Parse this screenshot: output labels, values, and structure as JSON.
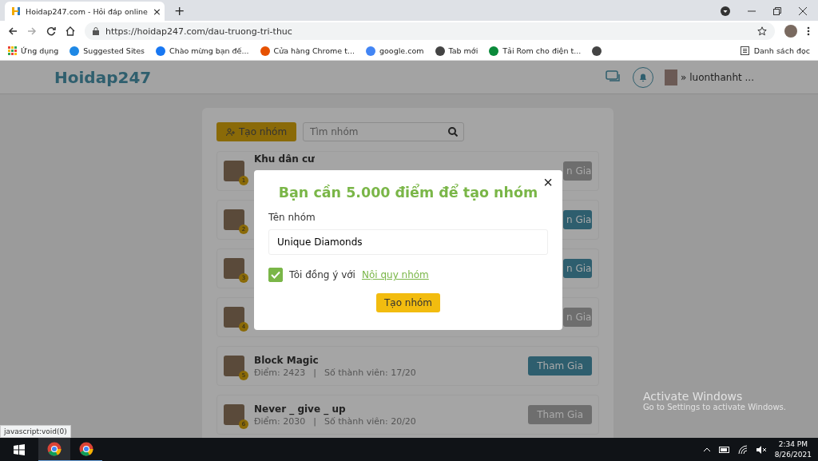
{
  "browser": {
    "tab_title": "Hoidap247.com - Hỏi đáp online",
    "close_tab": "×",
    "new_tab": "+",
    "url": "https://hoidap247.com/dau-truong-tri-thuc",
    "bookmarks": [
      "Ứng dụng",
      "Suggested Sites",
      "Chào mừng bạn đế...",
      "Cửa hàng Chrome t...",
      "google.com",
      "Tab mới",
      "Tải Rom cho điện t..."
    ],
    "reading_list": "Danh sách đọc"
  },
  "header": {
    "logo": "Hoidap247",
    "username_caret": "»",
    "username": "luonthanht ..."
  },
  "toolbar": {
    "create_button": "Tạo nhóm",
    "search_placeholder": "Tìm nhóm"
  },
  "groups": [
    {
      "badge": "1",
      "name": "Khu dân cư",
      "button": "n Gia",
      "available": false
    },
    {
      "badge": "2",
      "button": "n Gia",
      "available": true
    },
    {
      "badge": "3",
      "button": "n Gia",
      "available": true
    },
    {
      "badge": "4",
      "button": "n Gia",
      "available": false
    },
    {
      "badge": "5",
      "name": "Block Magic",
      "points": "Điểm: 2423",
      "separator": "|",
      "members": "Số thành viên: 17/20",
      "button": "Tham Gia",
      "available": true
    },
    {
      "badge": "6",
      "name": "Never _ give _ up",
      "points": "Điểm: 2030",
      "separator": "|",
      "members": "Số thành viên: 20/20",
      "button": "Tham Gia",
      "available": false
    }
  ],
  "dialog": {
    "close": "×",
    "title": "Bạn cần 5.000 điểm để tạo nhóm",
    "field_label": "Tên nhóm",
    "field_value": "Unique Diamonds",
    "agree_checked": true,
    "agree_text": "Tôi đồng ý với",
    "agree_link": "Nội quy nhóm",
    "submit": "Tạo nhóm"
  },
  "status_url": "javascript:void(0)",
  "activation": {
    "title": "Activate Windows",
    "subtitle": "Go to Settings to activate Windows."
  },
  "taskbar": {
    "time": "2:34 PM",
    "date": "8/26/2021"
  }
}
